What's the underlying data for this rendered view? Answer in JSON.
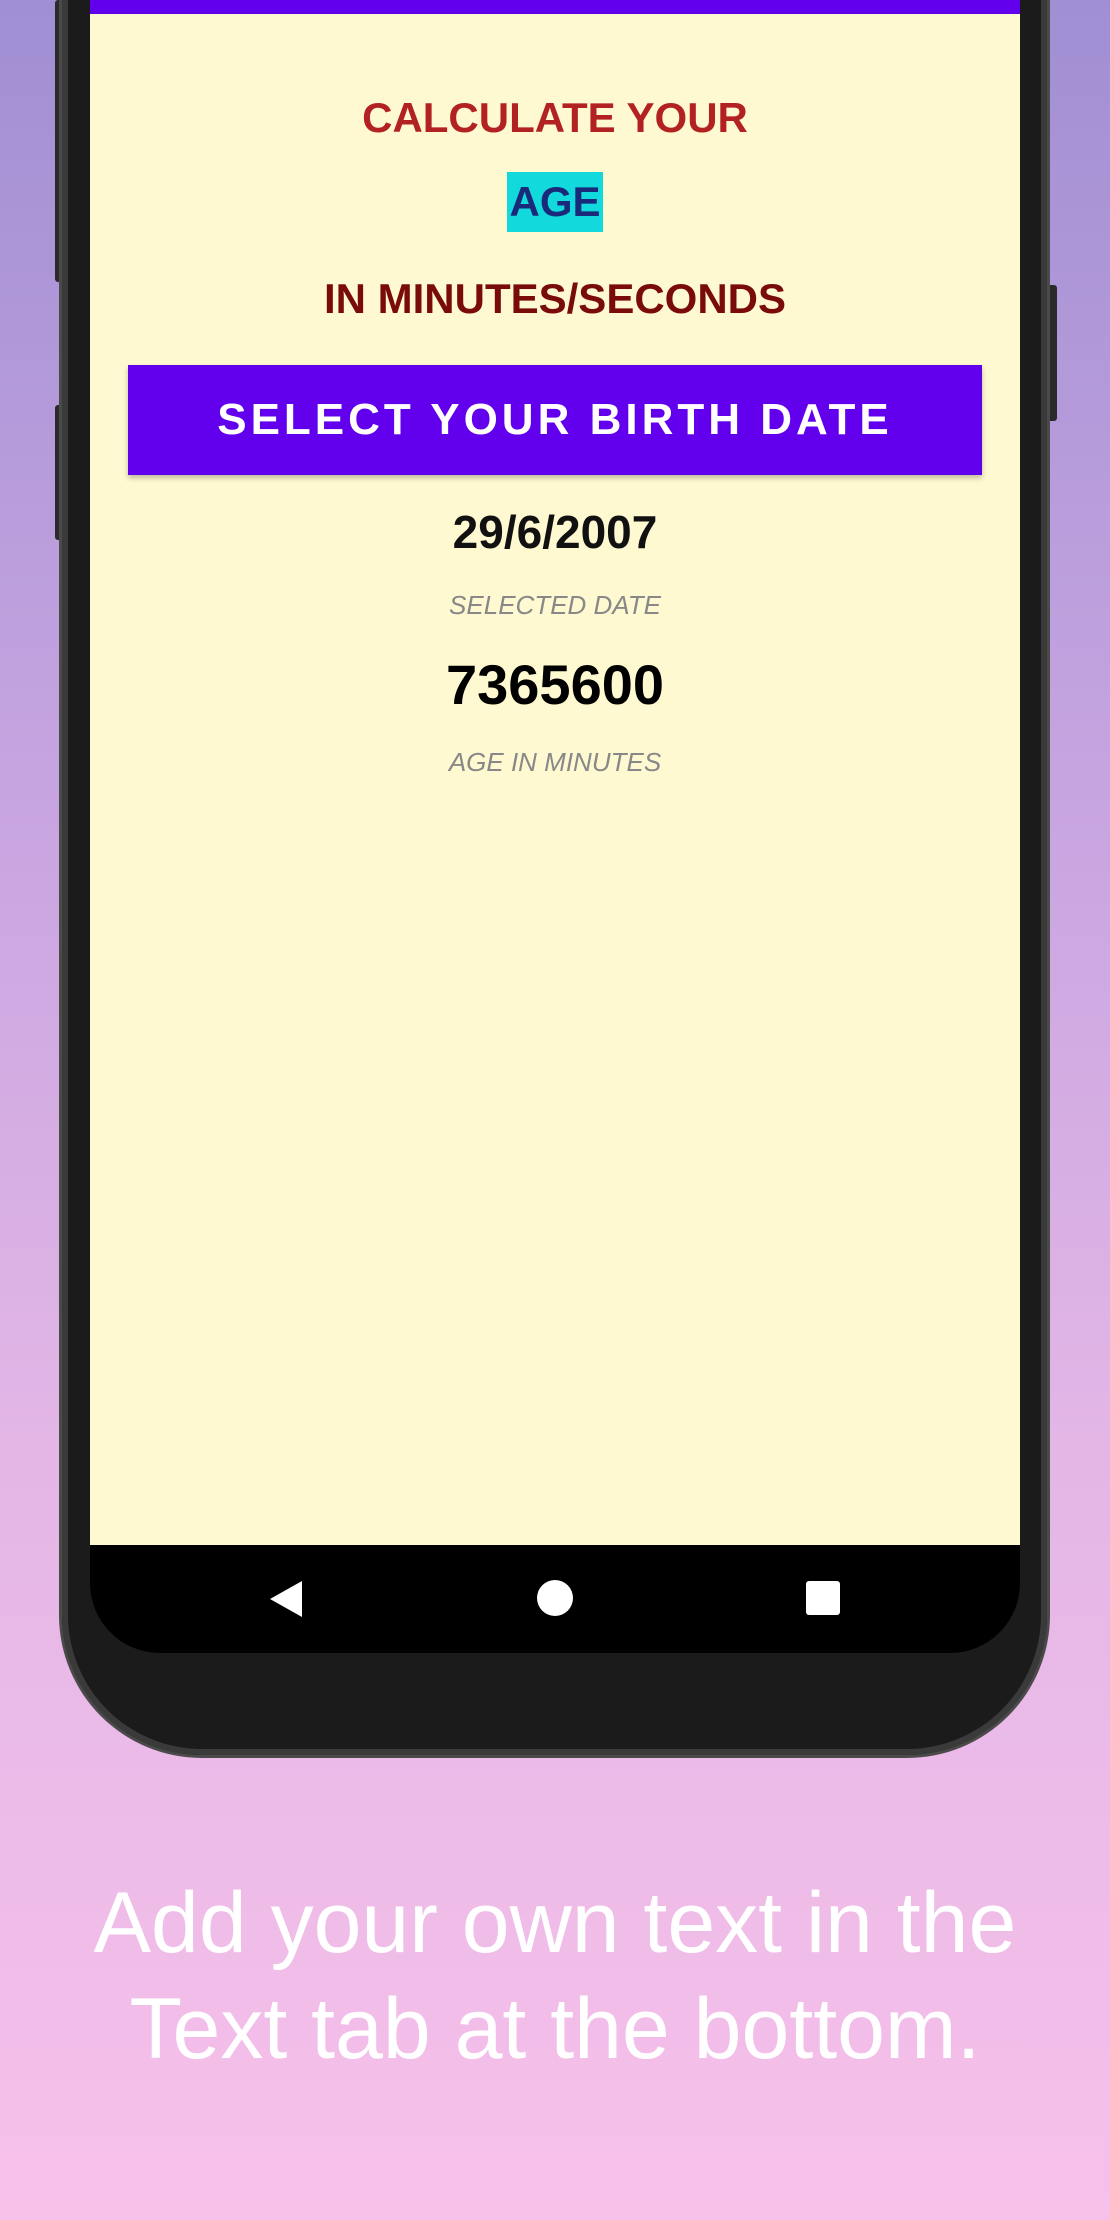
{
  "app": {
    "title_line1": "CALCULATE YOUR",
    "title_line2": "AGE",
    "title_line3": "IN MINUTES/SECONDS",
    "select_button_label": "SELECT YOUR BIRTH DATE",
    "selected_date_value": "29/6/2007",
    "selected_date_label": "SELECTED DATE",
    "age_in_minutes_value": "7365600",
    "age_in_minutes_label": "AGE IN MINUTES"
  },
  "nav": {
    "back_icon": "back-triangle-icon",
    "home_icon": "home-circle-icon",
    "recent_icon": "recent-square-icon"
  },
  "caption": {
    "line1": "Add your own text in the",
    "line2": "Text tab at the bottom."
  },
  "colors": {
    "accent": "#6200ee",
    "screen_bg": "#fff9d1",
    "title_red": "#b22222",
    "title_dark_red": "#7a0b0b",
    "age_highlight": "#11d9dc"
  }
}
